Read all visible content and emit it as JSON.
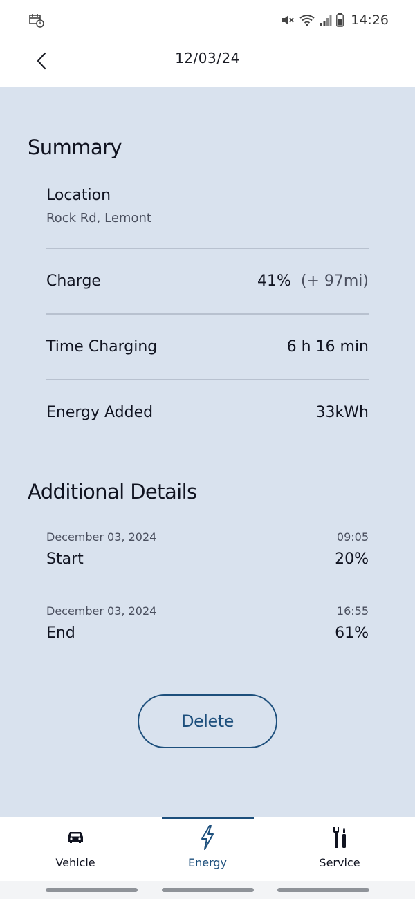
{
  "status_bar": {
    "time": "14:26",
    "icons": [
      "calendar-clock-icon",
      "mute-icon",
      "wifi-icon",
      "signal-icon",
      "battery-icon"
    ]
  },
  "header": {
    "title": "12/03/24",
    "back_icon": "chevron-left-icon"
  },
  "summary": {
    "title": "Summary",
    "location_label": "Location",
    "location_value": "Rock Rd, Lemont",
    "rows": [
      {
        "label": "Charge",
        "value": "41%",
        "extra": "(+ 97mi)"
      },
      {
        "label": "Time Charging",
        "value": "6 h 16 min"
      },
      {
        "label": "Energy Added",
        "value": "33kWh"
      }
    ]
  },
  "additional": {
    "title": "Additional Details",
    "items": [
      {
        "date": "December 03, 2024",
        "time": "09:05",
        "label": "Start",
        "value": "20%"
      },
      {
        "date": "December 03, 2024",
        "time": "16:55",
        "label": "End",
        "value": "61%"
      }
    ]
  },
  "delete_button": {
    "label": "Delete"
  },
  "bottom_nav": {
    "items": [
      {
        "label": "Vehicle",
        "icon": "car-icon",
        "active": false
      },
      {
        "label": "Energy",
        "icon": "lightning-icon",
        "active": true
      },
      {
        "label": "Service",
        "icon": "tools-icon",
        "active": false
      }
    ]
  },
  "colors": {
    "background": "#d9e2ee",
    "accent": "#1d4f7c",
    "text": "#101320",
    "secondary_text": "#4a4f5e"
  }
}
